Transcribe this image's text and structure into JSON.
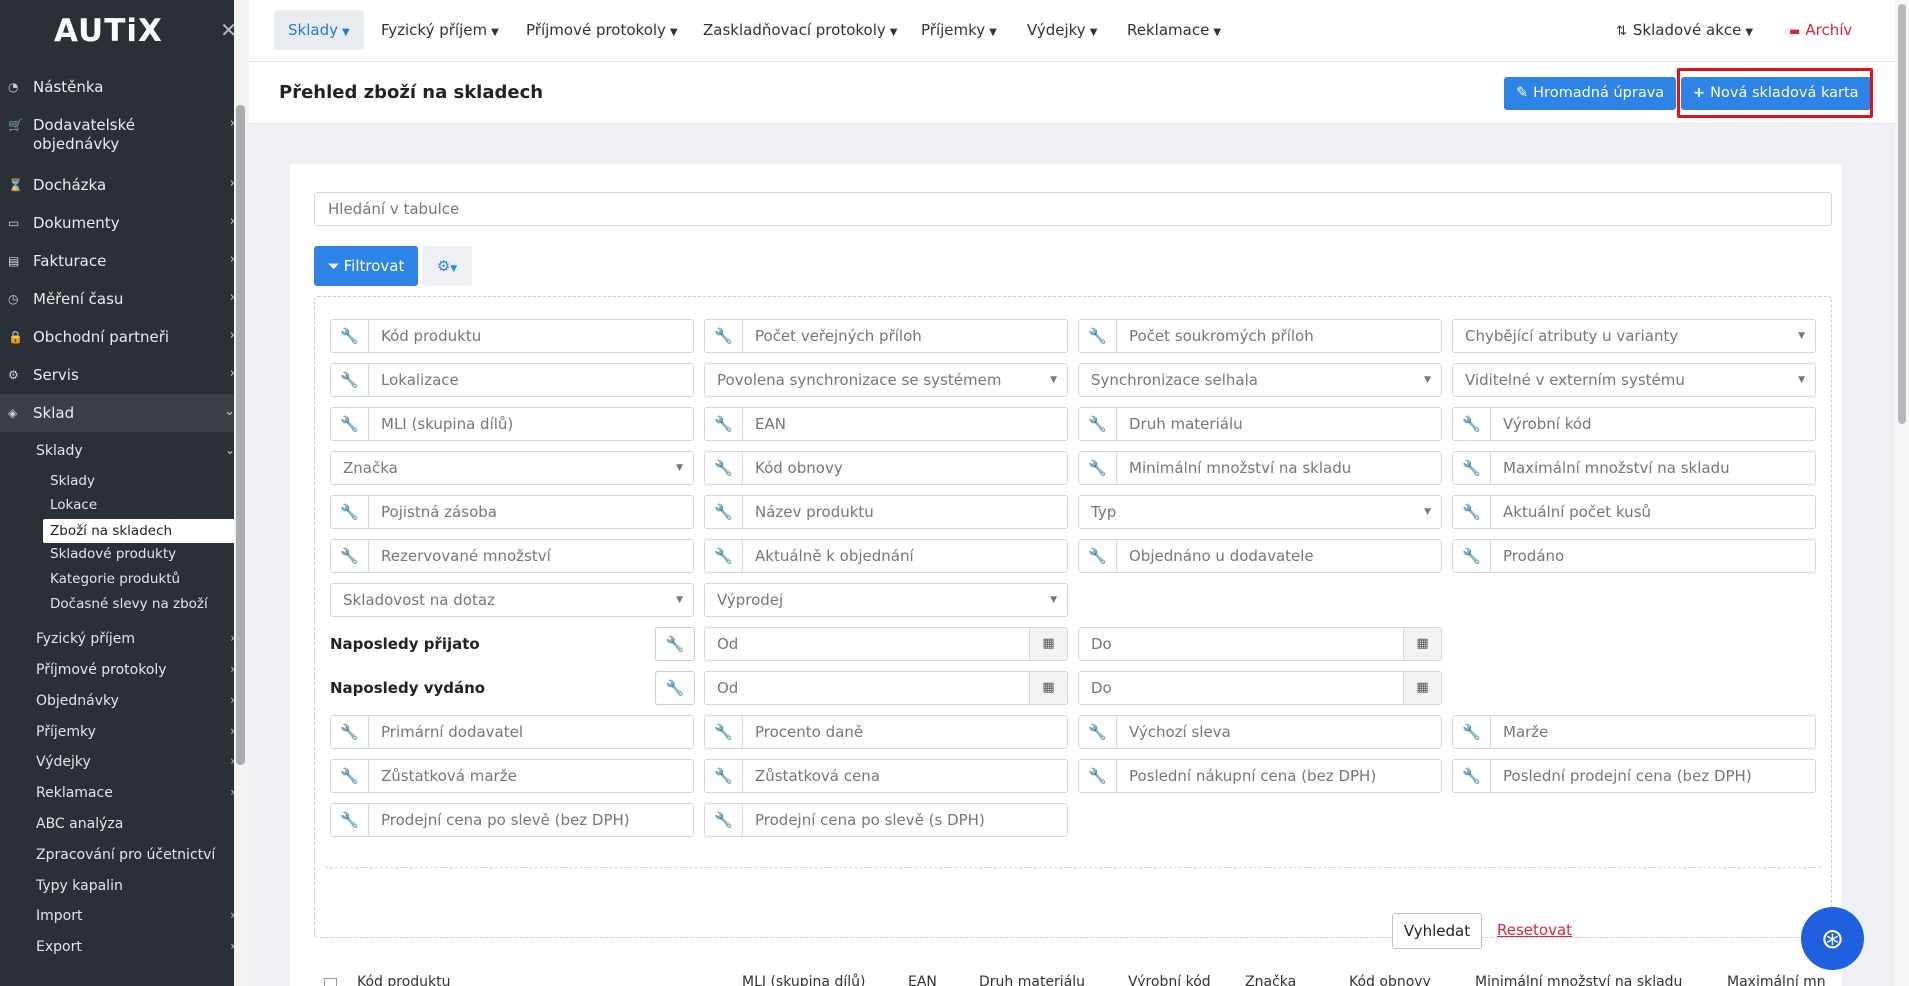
{
  "app": {
    "logo": "AUTiX"
  },
  "sidebar": {
    "items": [
      {
        "label": "Nástěnka",
        "icon": "dashboard-icon"
      },
      {
        "label": "Dodavatelské objednávky",
        "icon": "cart-icon"
      },
      {
        "label": "Docházka",
        "icon": "hourglass-icon"
      },
      {
        "label": "Dokumenty",
        "icon": "folder-icon"
      },
      {
        "label": "Fakturace",
        "icon": "invoice-icon"
      },
      {
        "label": "Měření času",
        "icon": "clock-icon"
      },
      {
        "label": "Obchodní partneři",
        "icon": "lock-icon"
      },
      {
        "label": "Servis",
        "icon": "cogs-icon"
      },
      {
        "label": "Sklad",
        "icon": "box-icon"
      }
    ],
    "sklad_sub": [
      {
        "label": "Sklady"
      },
      {
        "label": "Fyzický příjem"
      },
      {
        "label": "Příjmové protokoly"
      },
      {
        "label": "Objednávky"
      },
      {
        "label": "Příjemky"
      },
      {
        "label": "Výdejky"
      },
      {
        "label": "Reklamace"
      },
      {
        "label": "ABC analýza"
      },
      {
        "label": "Zpracování pro účetnictví"
      },
      {
        "label": "Typy kapalin"
      },
      {
        "label": "Import"
      },
      {
        "label": "Export"
      }
    ],
    "sklady_sub": [
      "Sklady",
      "Lokace",
      "Zboží na skladech",
      "Skladové produkty",
      "Kategorie produktů",
      "Dočasné slevy na zboží"
    ]
  },
  "topnav": {
    "items": [
      "Sklady",
      "Fyzický příjem",
      "Příjmové protokoly",
      "Zaskladňovací protokoly",
      "Příjemky",
      "Výdejky",
      "Reklamace"
    ],
    "actions": "Skladové akce",
    "archive": "Archív"
  },
  "header": {
    "title": "Přehled zboží na skladech",
    "bulk_edit": "Hromadná úprava",
    "new_card": "Nová skladová karta"
  },
  "search": {
    "placeholder": "Hledání v tabulce"
  },
  "filter": {
    "button": "Filtrovat",
    "fields": [
      "Kód produktu",
      "Počet veřejných příloh",
      "Počet soukromých příloh",
      "Chybějící atributy u varianty",
      "Lokalizace",
      "Povolena synchronizace se systémem",
      "Synchronizace selhala",
      "Viditelné v externím systému",
      "MLI (skupina dílů)",
      "EAN",
      "Druh materiálu",
      "Výrobní kód",
      "Značka",
      "Kód obnovy",
      "Minimální množství na skladu",
      "Maximální množství na skladu",
      "Pojistná zásoba",
      "Název produktu",
      "Typ",
      "Aktuální počet kusů",
      "Rezervované množství",
      "Aktuálně k objednání",
      "Objednáno u dodavatele",
      "Prodáno",
      "Skladovost na dotaz",
      "Výprodej",
      "Primární dodavatel",
      "Procento daně",
      "Výchozí sleva",
      "Marže",
      "Zůstatková marže",
      "Zůstatková cena",
      "Poslední nákupní cena (bez DPH)",
      "Poslední prodejní cena (bez DPH)",
      "Prodejní cena po slevě (bez DPH)",
      "Prodejní cena po slevě (s DPH)"
    ],
    "last_received": "Naposledy přijato",
    "last_issued": "Naposledy vydáno",
    "from": "Od",
    "to": "Do",
    "search_button": "Vyhledat",
    "reset_link": "Resetovat"
  },
  "table": {
    "headers": [
      "Kód produktu",
      "MLI (skupina dílů)",
      "EAN",
      "Druh materiálu",
      "Výrobní kód",
      "Značka",
      "Kód obnovy",
      "Minimální množství na skladu",
      "Maximální mn"
    ]
  }
}
